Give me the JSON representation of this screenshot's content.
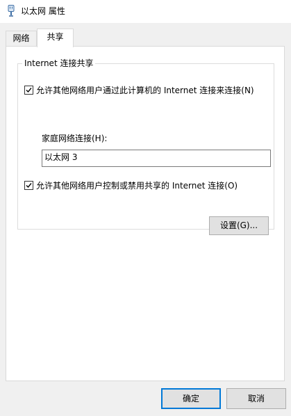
{
  "window": {
    "title": "以太网 属性",
    "icon": "ethernet-adapter-icon"
  },
  "tabs": [
    {
      "label": "网络",
      "selected": false
    },
    {
      "label": "共享",
      "selected": true
    }
  ],
  "sharing": {
    "group_title": "Internet 连接共享",
    "allow_share": {
      "label": "允许其他网络用户通过此计算机的 Internet 连接来连接(N)",
      "checked": true
    },
    "home_network": {
      "label": "家庭网络连接(H):",
      "value": "以太网 3"
    },
    "allow_control": {
      "label": "允许其他网络用户控制或禁用共享的 Internet 连接(O)",
      "checked": true
    },
    "settings_button": "设置(G)..."
  },
  "footer": {
    "ok_label": "确定",
    "cancel_label": "取消"
  },
  "colors": {
    "accent": "#0078d7",
    "window_bg": "#f0f0f0",
    "panel_bg": "#ffffff"
  }
}
